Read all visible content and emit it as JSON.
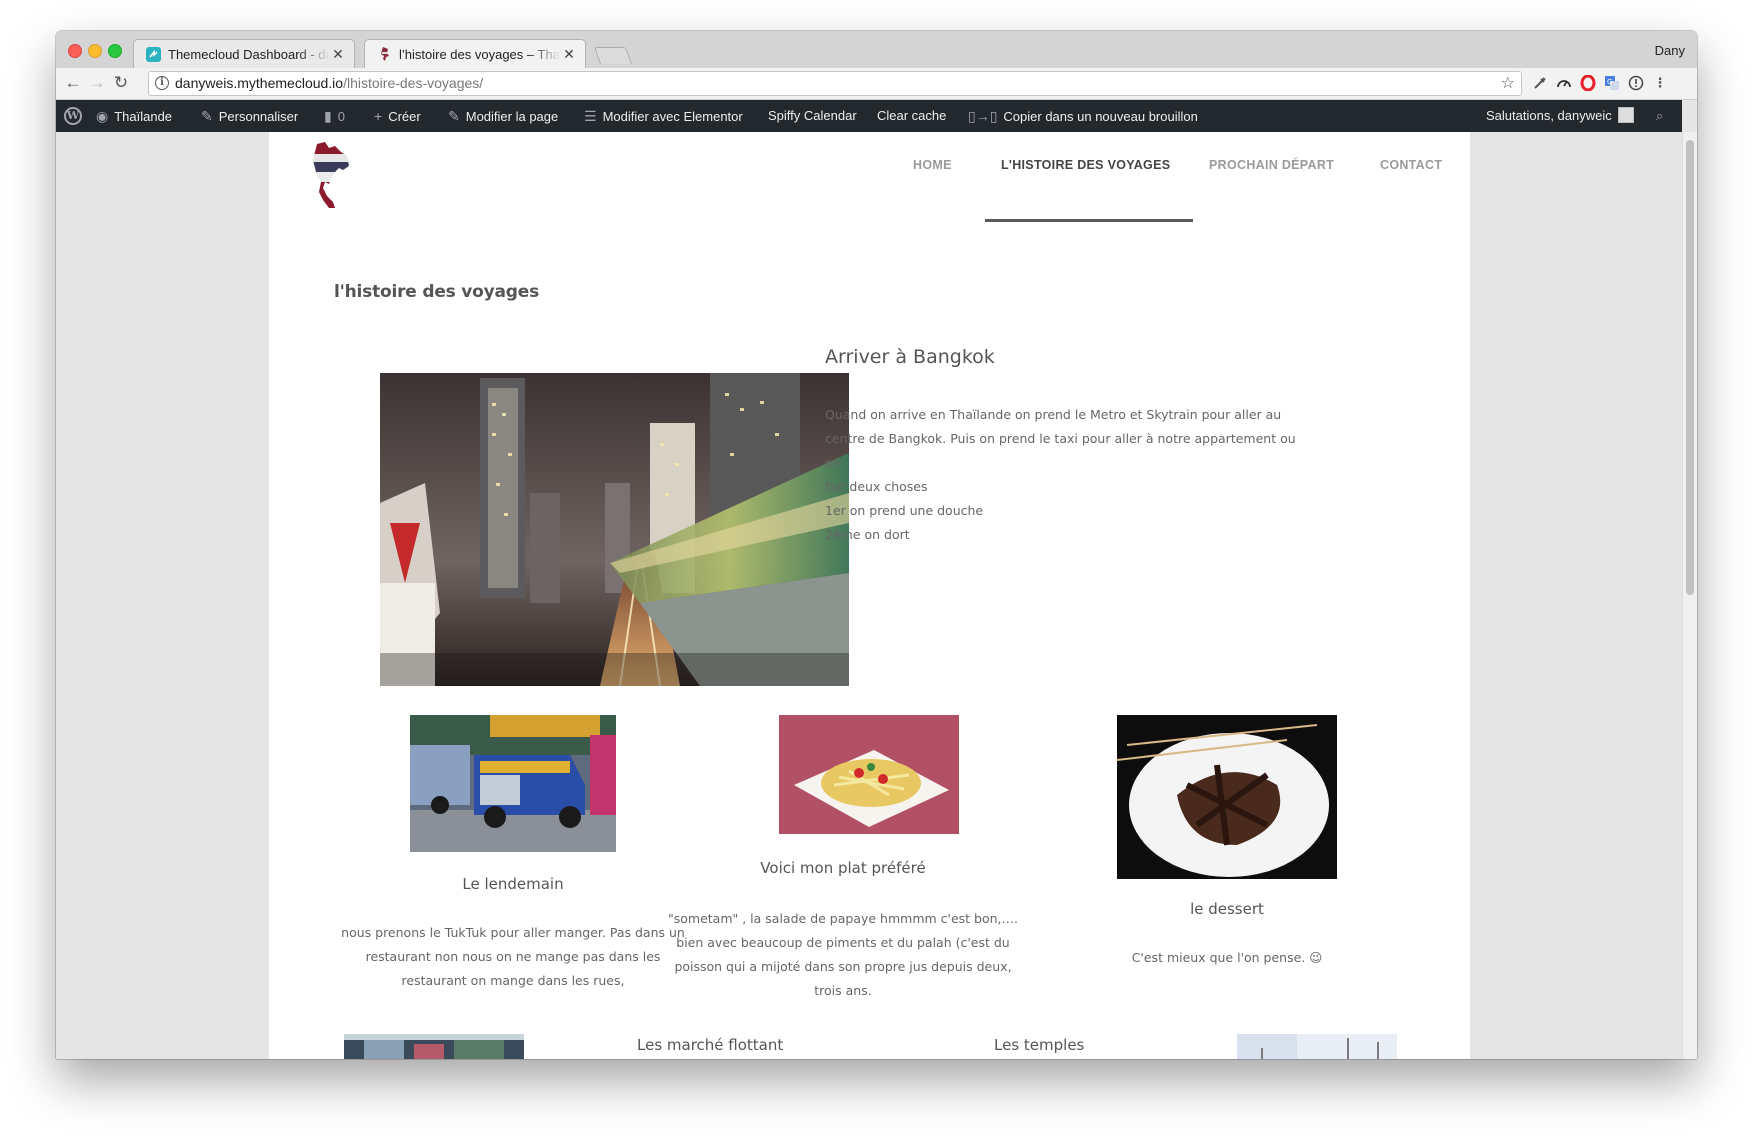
{
  "browser": {
    "tabs": [
      {
        "title": "Themecloud Dashboard - dany",
        "close": "✕"
      },
      {
        "title": "l’histoire des voyages – Thailande",
        "close": "✕"
      }
    ],
    "profile_name": "Dany",
    "url_host": "danyweis.mythemecloud.io",
    "url_path": "/lhistoire-des-voyages/"
  },
  "admin_bar": {
    "site_name": "Thaïlande",
    "customize": "Personnaliser",
    "comments_count": "0",
    "new": "Créer",
    "edit_page": "Modifier la page",
    "edit_elementor": "Modifier avec Elementor",
    "spiffy_calendar": "Spiffy Calendar",
    "clear_cache": "Clear cache",
    "copy_draft": "Copier dans un nouveau brouillon",
    "greeting": "Salutations, danyweic"
  },
  "site_nav": [
    {
      "label": "HOME"
    },
    {
      "label": "L'HISTOIRE DES VOYAGES"
    },
    {
      "label": "PROCHAIN DÉPART"
    },
    {
      "label": "CONTACT"
    }
  ],
  "page": {
    "title": "l'histoire des voyages",
    "hero": {
      "heading": "Arriver à Bangkok",
      "lines": [
        "Quand on arrive en Thaïlande on prend le Metro et Skytrain pour aller au",
        "centre de Bangkok. Puis on prend le taxi pour aller à notre appartement ou on",
        "fait deux choses",
        "1er on prend une douche",
        "2ème on dort"
      ]
    },
    "cards": [
      {
        "heading": "Le lendemain",
        "lines": [
          "nous prenons le TukTuk pour aller manger. Pas dans un",
          "restaurant non nous on ne mange pas dans les",
          "restaurant on mange dans les rues,"
        ]
      },
      {
        "heading": "Voici mon plat préféré",
        "lines": [
          "\"sometam\" , la salade de papaye hmmmm c'est bon,….",
          "bien avec beaucoup de piments et du palah (c'est du",
          "poisson qui a mijoté dans son propre jus depuis deux,",
          "trois ans."
        ]
      },
      {
        "heading": "le dessert",
        "lines": [
          "C'est mieux que l'on pense. 😉"
        ]
      }
    ],
    "bottom_headings": [
      "Les marché flottant",
      "Les temples"
    ]
  }
}
